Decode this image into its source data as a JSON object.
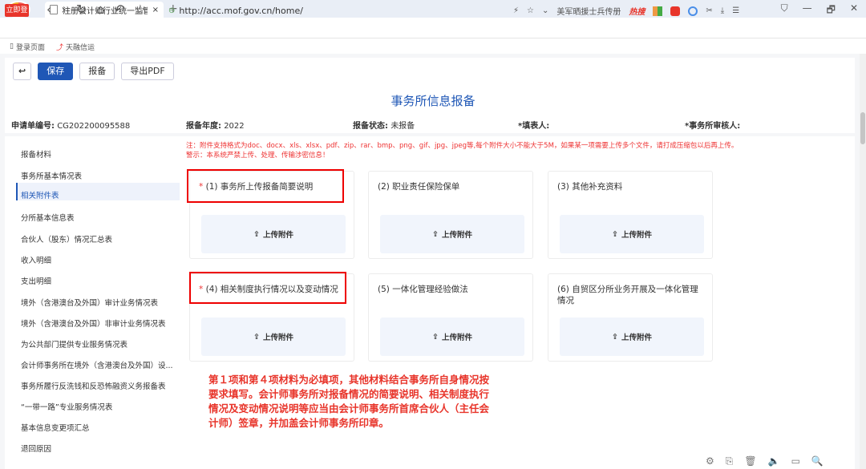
{
  "browser": {
    "tab_title": "注册会计师行业统一监管平台",
    "tab_close": "×",
    "new_tab": "+",
    "win_controls": [
      "⛉",
      "—",
      "🗗",
      "✕"
    ],
    "login_badge": "立即登录",
    "nav_glyphs": [
      "‹",
      "›",
      "↻",
      "⌂",
      "↶",
      "☆"
    ],
    "url": "http://acc.mof.gov.cn/home/",
    "right_text": "美军晒援士兵传册",
    "hot_label": "热搜",
    "bookmarks": [
      "登录页面",
      "天融信运"
    ]
  },
  "toolbar": {
    "back_icon": "↩",
    "save": "保存",
    "report": "报备",
    "export": "导出PDF"
  },
  "form": {
    "title": "事务所信息报备",
    "app_no_label": "申请单编号:",
    "app_no": "CG202200095588",
    "year_label": "报备年度:",
    "year": "2022",
    "status_label": "报备状态:",
    "status": "未报备",
    "filler_label": "*填表人:",
    "reviewer_label": "*事务所审核人:"
  },
  "sidebar": {
    "items": [
      "报备材料",
      "事务所基本情况表",
      "相关附件表",
      "分所基本信息表",
      "合伙人（股东）情况汇总表",
      "收入明细",
      "支出明细",
      "境外（含港澳台及外国）审计业务情况表",
      "境外（含港澳台及外国）非审计业务情况表",
      "为公共部门提供专业服务情况表",
      "会计师事务所在境外（含港澳台及外国）设...",
      "事务所履行反洗钱和反恐怖融资义务报备表",
      "“一带一路”专业服务情况表",
      "基本信息变更项汇总",
      "退回原因"
    ]
  },
  "notes": {
    "line1": "注：附件支持格式为doc、docx、xls、xlsx、pdf、zip、rar、bmp、png、gif、jpg、jpeg等,每个附件大小不能大于5M，如果某一项需要上传多个文件，请打成压缩包以后再上传。",
    "line2": "警示：本系统严禁上传、处理、传输涉密信息！"
  },
  "cards": [
    {
      "req": "*",
      "title": "(1) 事务所上传报备简要说明",
      "upload": "上传附件"
    },
    {
      "req": "",
      "title": "(2) 职业责任保险保单",
      "upload": "上传附件"
    },
    {
      "req": "",
      "title": "(3) 其他补充资料",
      "upload": "上传附件"
    },
    {
      "req": "*",
      "title": "(4) 相关制度执行情况以及变动情况",
      "upload": "上传附件"
    },
    {
      "req": "",
      "title": "(5) 一体化管理经验做法",
      "upload": "上传附件"
    },
    {
      "req": "",
      "title": "(6) 自贸区分所业务开展及一体化管理情况",
      "upload": "上传附件"
    }
  ],
  "annotation": "第１项和第４项材料为必填项，其他材料结合事务所自身情况按要求填写。会计师事务所对报备情况的简要说明、相关制度执行情况及变动情况说明等应当由会计师事务所首席合伙人（主任会计师）签章，并加盖会计师事务所印章。",
  "statusbar": [
    "⚙",
    "⎘",
    "🗑",
    "🔈",
    "▭",
    "🔍"
  ]
}
